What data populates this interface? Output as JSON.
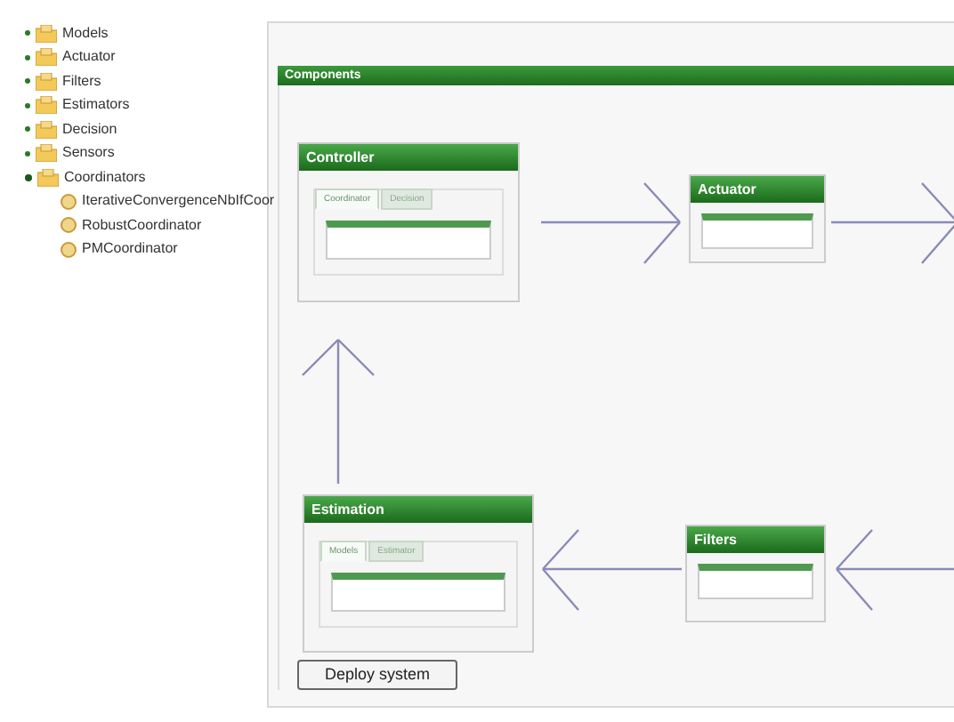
{
  "tree": [
    {
      "label": "Models",
      "expanded": false
    },
    {
      "label": "Actuator",
      "expanded": false
    },
    {
      "label": "Filters",
      "expanded": false
    },
    {
      "label": "Estimators",
      "expanded": false
    },
    {
      "label": "Decision",
      "expanded": false
    },
    {
      "label": "Sensors",
      "expanded": false
    },
    {
      "label": "Coordinators",
      "expanded": true,
      "children": [
        {
          "label": "IterativeConvergenceNbIfCoor"
        },
        {
          "label": "RobustCoordinator"
        },
        {
          "label": "PMCoordinator"
        }
      ]
    }
  ],
  "components": {
    "title": "Components",
    "nodes": [
      {
        "kind": "tabbed",
        "title": "Controller",
        "tabs": [
          {
            "label": "Coordinator",
            "selected": true
          },
          {
            "label": "Decision",
            "selected": false
          }
        ]
      },
      {
        "kind": "simple",
        "title": "Actuator"
      },
      {
        "kind": "tabbed",
        "title": "Estimation",
        "tabs": [
          {
            "label": "Models",
            "selected": true
          },
          {
            "label": "Estimator",
            "selected": false
          }
        ]
      },
      {
        "kind": "simple",
        "title": "Filters"
      }
    ],
    "deploy_button": "Deploy system"
  }
}
